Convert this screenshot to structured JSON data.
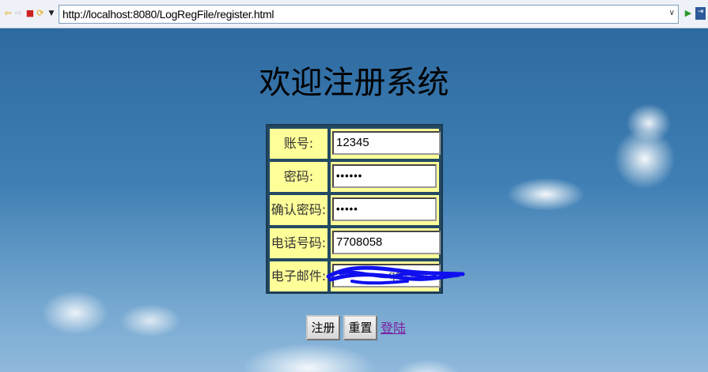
{
  "browser": {
    "url": "http://localhost:8080/LogRegFile/register.html"
  },
  "page": {
    "title": "欢迎注册系统"
  },
  "form": {
    "rows": [
      {
        "label": "账号:",
        "value": "12345",
        "type": "text"
      },
      {
        "label": "密码:",
        "value": "••••••",
        "type": "password"
      },
      {
        "label": "确认密码:",
        "value": "•••••",
        "type": "password"
      },
      {
        "label": "电话号码:",
        "value": "7708058",
        "type": "text"
      },
      {
        "label": "电子邮件:",
        "value": "qq.com x",
        "type": "email"
      }
    ]
  },
  "buttons": {
    "register": "注册",
    "reset": "重置",
    "login_link": "登陆"
  },
  "colors": {
    "label_bg": "#ffff99",
    "table_border": "#234a63",
    "link": "#7a1fa0"
  }
}
